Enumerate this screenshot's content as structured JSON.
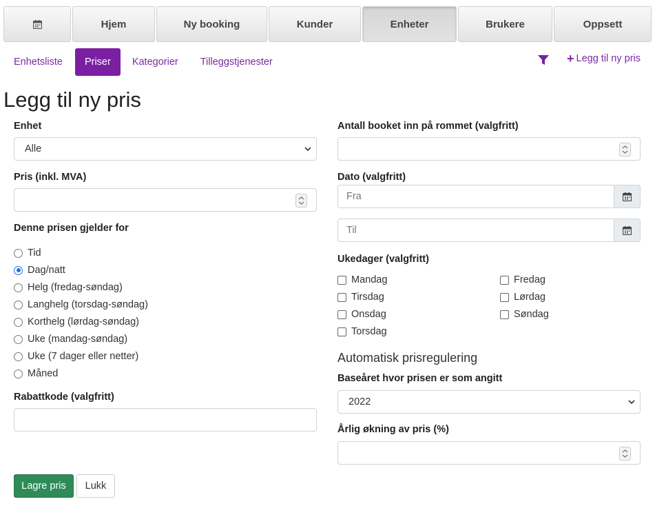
{
  "topnav": {
    "tabs": [
      {
        "label": "",
        "icon": "calendar-icon"
      },
      {
        "label": "Hjem"
      },
      {
        "label": "Ny booking"
      },
      {
        "label": "Kunder"
      },
      {
        "label": "Enheter",
        "active": true
      },
      {
        "label": "Brukere"
      },
      {
        "label": "Oppsett"
      }
    ]
  },
  "subnav": {
    "items": [
      "Enhetsliste",
      "Priser",
      "Kategorier",
      "Tilleggstjenester"
    ],
    "active": "Priser",
    "add_new_label": "Legg til ny pris"
  },
  "page_title": "Legg til ny pris",
  "form": {
    "unit_label": "Enhet",
    "unit_value": "Alle",
    "price_label": "Pris (inkl. MVA)",
    "applies_label": "Denne prisen gjelder for",
    "applies_options": [
      "Tid",
      "Dag/natt",
      "Helg (fredag-søndag)",
      "Langhelg (torsdag-søndag)",
      "Korthelg (lørdag-søndag)",
      "Uke (mandag-søndag)",
      "Uke (7 dager eller netter)",
      "Måned"
    ],
    "applies_selected": "Dag/natt",
    "discount_label": "Rabattkode (valgfritt)",
    "booked_label": "Antall booket inn på rommet (valgfritt)",
    "date_label": "Dato (valgfritt)",
    "date_from_placeholder": "Fra",
    "date_to_placeholder": "Til",
    "weekdays_label": "Ukedager (valgfritt)",
    "weekdays_left": [
      "Mandag",
      "Tirsdag",
      "Onsdag",
      "Torsdag"
    ],
    "weekdays_right": [
      "Fredag",
      "Lørdag",
      "Søndag"
    ],
    "auto_section_title": "Automatisk prisregulering",
    "base_year_label": "Baseåret hvor prisen er som angitt",
    "base_year_value": "2022",
    "annual_increase_label": "Årlig økning av pris (%)"
  },
  "buttons": {
    "save": "Lagre pris",
    "close": "Lukk"
  },
  "colors": {
    "accent": "#7b1fa2",
    "save": "#2e8b57",
    "radio_selected": "#1e73e8"
  }
}
